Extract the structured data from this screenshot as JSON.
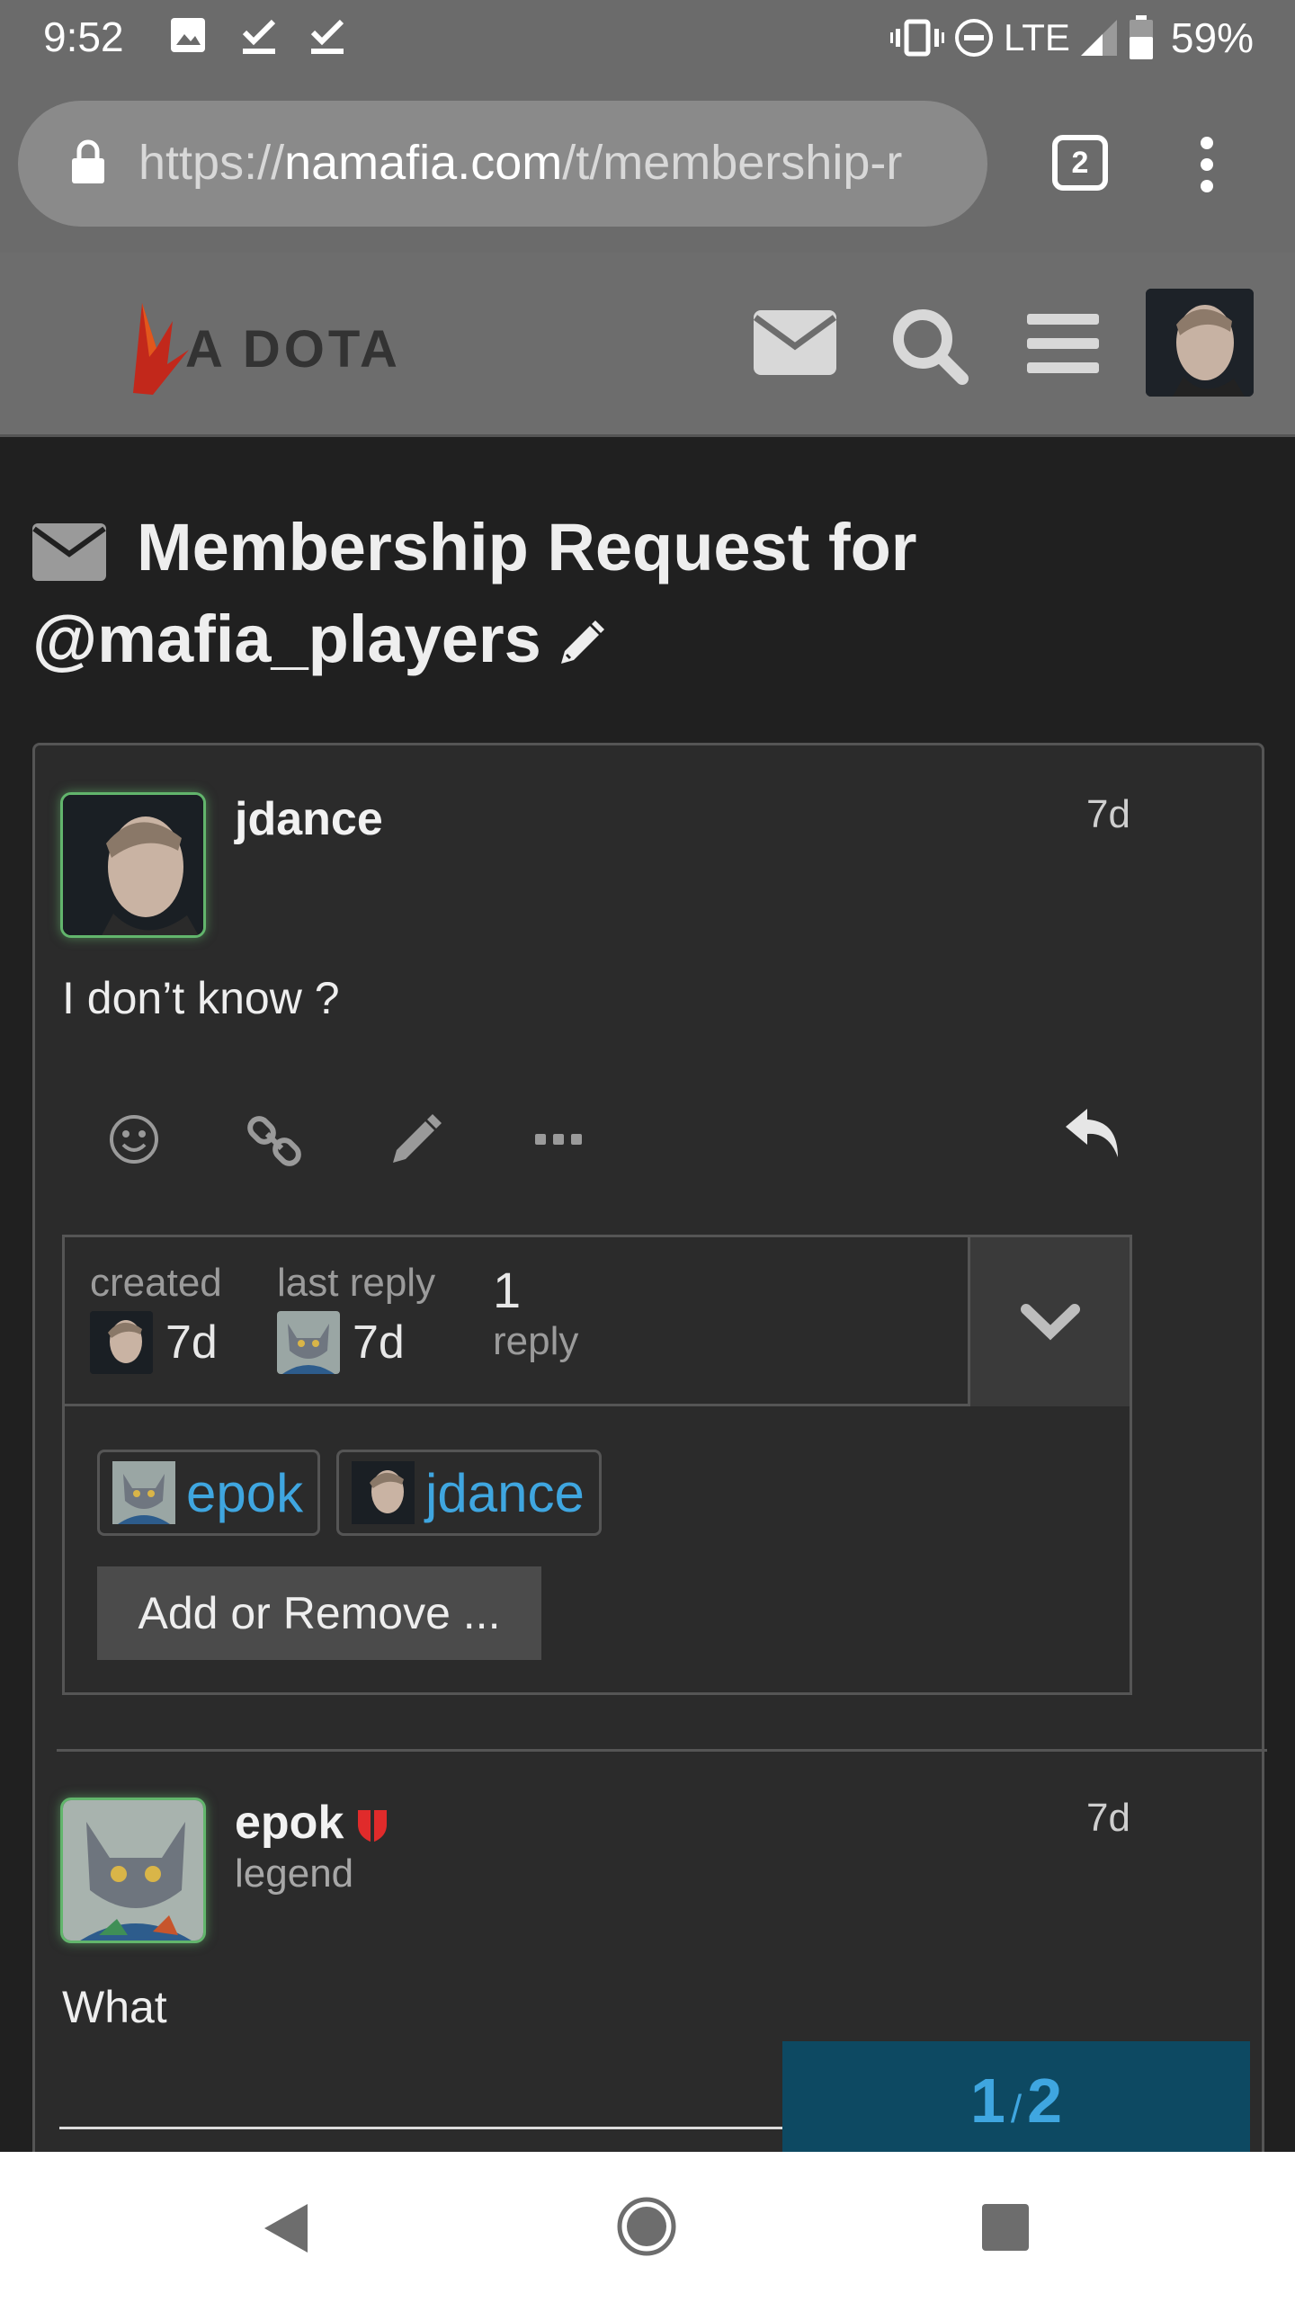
{
  "status_bar": {
    "time": "9:52",
    "network": "LTE",
    "battery": "59%"
  },
  "browser": {
    "url_scheme": "https://",
    "url_host": "namafia.com",
    "url_path": "/t/membership-r",
    "tab_count": "2"
  },
  "site": {
    "logo_text": "A DOTA",
    "icons": [
      "envelope-icon",
      "search-icon",
      "hamburger-icon",
      "avatar"
    ]
  },
  "topic": {
    "title": "Membership Request for @mafia_players"
  },
  "posts": [
    {
      "username": "jdance",
      "age": "7d",
      "body": "I don’t know ?"
    },
    {
      "username": "epok",
      "user_title": "legend",
      "age": "7d",
      "body": "What"
    }
  ],
  "topic_map": {
    "created_label": "created",
    "created_age": "7d",
    "last_reply_label": "last reply",
    "last_reply_age": "7d",
    "reply_count": "1",
    "reply_label": "reply",
    "participants": [
      "epok",
      "jdance"
    ],
    "add_remove_label": "Add or Remove ..."
  },
  "timeline": {
    "current": "1",
    "separator": "/",
    "total": "2"
  },
  "colors": {
    "accent": "#3fa6e0",
    "timeline_bg": "#0d4962",
    "avatar_ring": "#62b56c",
    "moderator_shield": "#e02b2b"
  }
}
